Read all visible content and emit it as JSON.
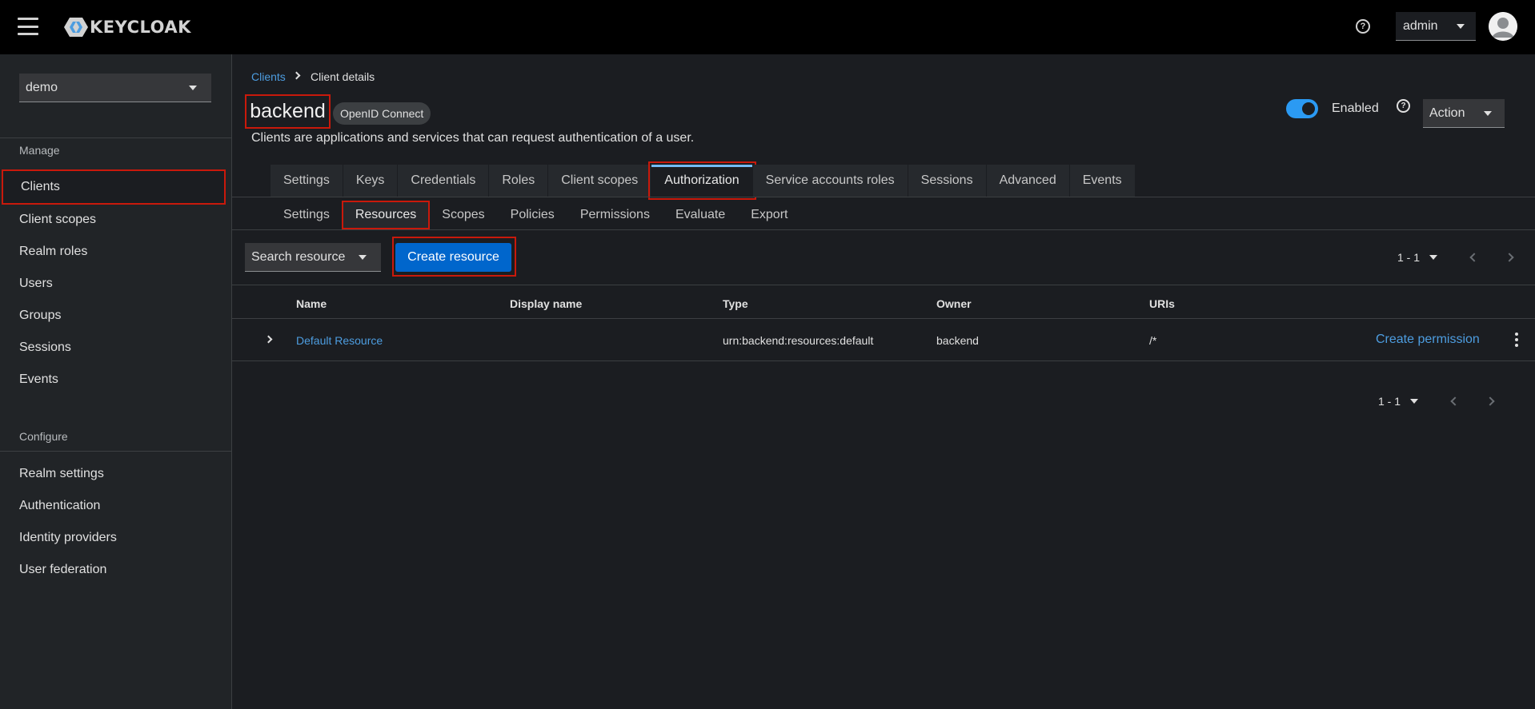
{
  "masthead": {
    "brand": "KEYCLOAK",
    "user": "admin"
  },
  "sidebar": {
    "realm": "demo",
    "manage_heading": "Manage",
    "manage_items": [
      "Clients",
      "Client scopes",
      "Realm roles",
      "Users",
      "Groups",
      "Sessions",
      "Events"
    ],
    "configure_heading": "Configure",
    "configure_items": [
      "Realm settings",
      "Authentication",
      "Identity providers",
      "User federation"
    ]
  },
  "breadcrumb": {
    "parent": "Clients",
    "current": "Client details"
  },
  "header": {
    "title": "backend",
    "protocol_label": "OpenID Connect",
    "subtitle": "Clients are applications and services that can request authentication of a user.",
    "enabled_label": "Enabled",
    "action_label": "Action"
  },
  "tabs": [
    "Settings",
    "Keys",
    "Credentials",
    "Roles",
    "Client scopes",
    "Authorization",
    "Service accounts roles",
    "Sessions",
    "Advanced",
    "Events"
  ],
  "active_tab": "Authorization",
  "subtabs": [
    "Settings",
    "Resources",
    "Scopes",
    "Policies",
    "Permissions",
    "Evaluate",
    "Export"
  ],
  "active_subtab": "Resources",
  "toolbar": {
    "search_label": "Search resource",
    "create_label": "Create resource",
    "pagination": "1 - 1"
  },
  "table": {
    "columns": [
      "Name",
      "Display name",
      "Type",
      "Owner",
      "URIs"
    ],
    "rows": [
      {
        "name": "Default Resource",
        "display_name": "",
        "type": "urn:backend:resources:default",
        "owner": "backend",
        "uris": "/*",
        "action": "Create permission"
      }
    ]
  },
  "footer_pagination": "1 - 1",
  "colors": {
    "accent": "#0066cc",
    "link": "#4d9de0",
    "highlight": "#c9190b",
    "switch_on": "#2b9af3"
  }
}
